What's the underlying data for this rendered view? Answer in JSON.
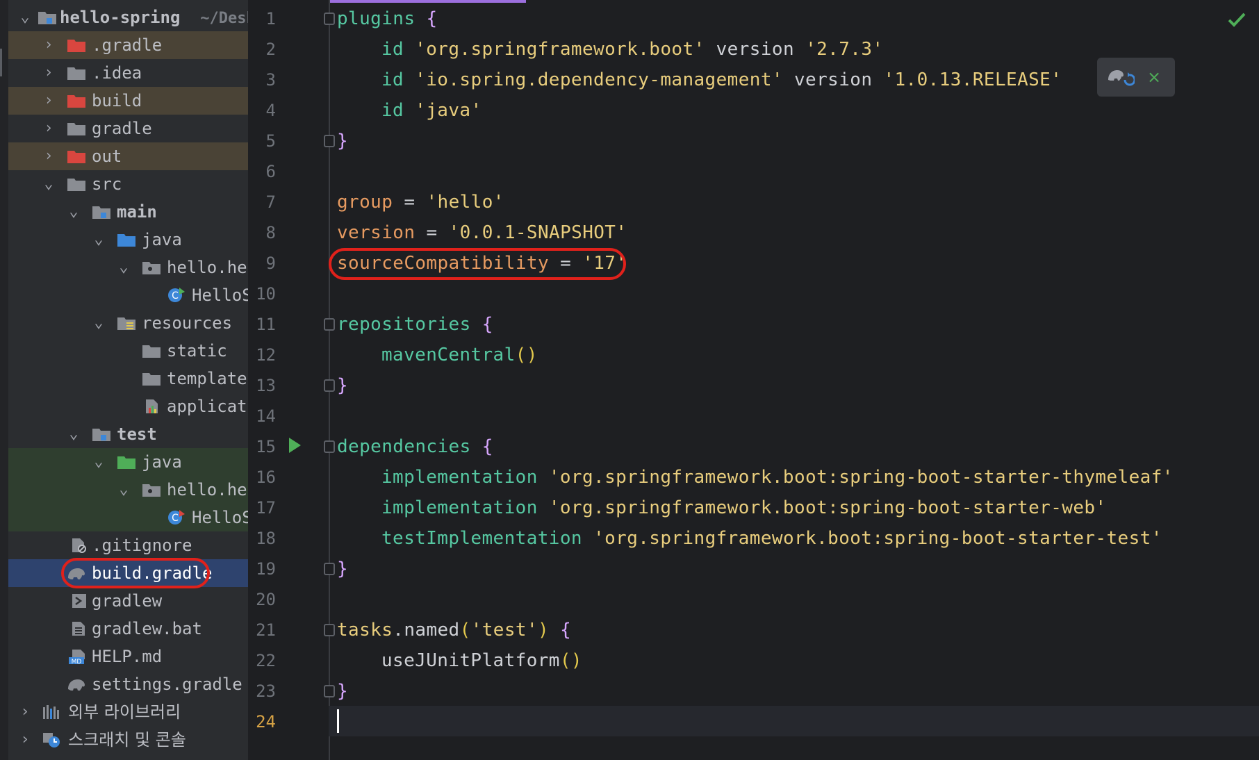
{
  "project": {
    "name": "hello-spring",
    "path_hint": "~/Desk"
  },
  "tree": [
    {
      "label": ".gradle"
    },
    {
      "label": ".idea"
    },
    {
      "label": "build"
    },
    {
      "label": "gradle"
    },
    {
      "label": "out"
    },
    {
      "label": "src"
    },
    {
      "label": "main"
    },
    {
      "label": "java"
    },
    {
      "label": "hello.hel"
    },
    {
      "label": "HelloS"
    },
    {
      "label": "resources"
    },
    {
      "label": "static"
    },
    {
      "label": "templates"
    },
    {
      "label": "applicati"
    },
    {
      "label": "test"
    },
    {
      "label": "java"
    },
    {
      "label": "hello.hel"
    },
    {
      "label": "HelloS"
    },
    {
      "label": ".gitignore"
    },
    {
      "label": "build.gradle"
    },
    {
      "label": "gradlew"
    },
    {
      "label": "gradlew.bat"
    },
    {
      "label": "HELP.md"
    },
    {
      "label": "settings.gradle"
    },
    {
      "label": "외부 라이브러리"
    },
    {
      "label": "스크래치 및 콘솔"
    }
  ],
  "line_numbers": [
    "1",
    "2",
    "3",
    "4",
    "5",
    "6",
    "7",
    "8",
    "9",
    "10",
    "11",
    "12",
    "13",
    "14",
    "15",
    "16",
    "17",
    "18",
    "19",
    "20",
    "21",
    "22",
    "23",
    "24"
  ],
  "code": {
    "l1": {
      "kw": "plugins",
      "br": "{"
    },
    "l2": {
      "id": "id",
      "str": "'org.springframework.boot'",
      "ver": "version",
      "vstr": "'2.7.3'"
    },
    "l3": {
      "id": "id",
      "str": "'io.spring.dependency-management'",
      "ver": "version",
      "vstr": "'1.0.13.RELEASE'"
    },
    "l4": {
      "id": "id",
      "str": "'java'"
    },
    "l5": {
      "br": "}"
    },
    "l7": {
      "var": "group",
      "eq": "=",
      "str": "'hello'"
    },
    "l8": {
      "var": "version",
      "eq": "=",
      "str": "'0.0.1-SNAPSHOT'"
    },
    "l9": {
      "var": "sourceCompatibility",
      "eq": "=",
      "str": "'17'"
    },
    "l11": {
      "kw": "repositories",
      "br": "{"
    },
    "l12": {
      "fn": "mavenCentral",
      "par": "()"
    },
    "l13": {
      "br": "}"
    },
    "l15": {
      "kw": "dependencies",
      "br": "{"
    },
    "l16": {
      "kw": "implementation",
      "str": "'org.springframework.boot:spring-boot-starter-thymeleaf'"
    },
    "l17": {
      "kw": "implementation",
      "str": "'org.springframework.boot:spring-boot-starter-web'"
    },
    "l18": {
      "kw": "testImplementation",
      "str": "'org.springframework.boot:spring-boot-starter-test'"
    },
    "l19": {
      "br": "}"
    },
    "l21": {
      "obj": "tasks",
      "dot": ".",
      "fn": "named",
      "open": "(",
      "str": "'test'",
      "close": ")",
      "br": "{"
    },
    "l22": {
      "fn": "useJUnitPlatform",
      "par": "()"
    },
    "l23": {
      "br": "}"
    }
  },
  "colors": {
    "keyword": "#56c8a2",
    "string": "#e8cd7d",
    "variable": "#e79b61",
    "highlight_ring": "#e0211b",
    "selection": "#2e436e"
  },
  "icons": {
    "gradle_reload": "gradle-reload-icon",
    "close": "close-icon",
    "check": "check-icon",
    "run": "run-icon"
  },
  "popup": {
    "close_glyph": "×"
  }
}
